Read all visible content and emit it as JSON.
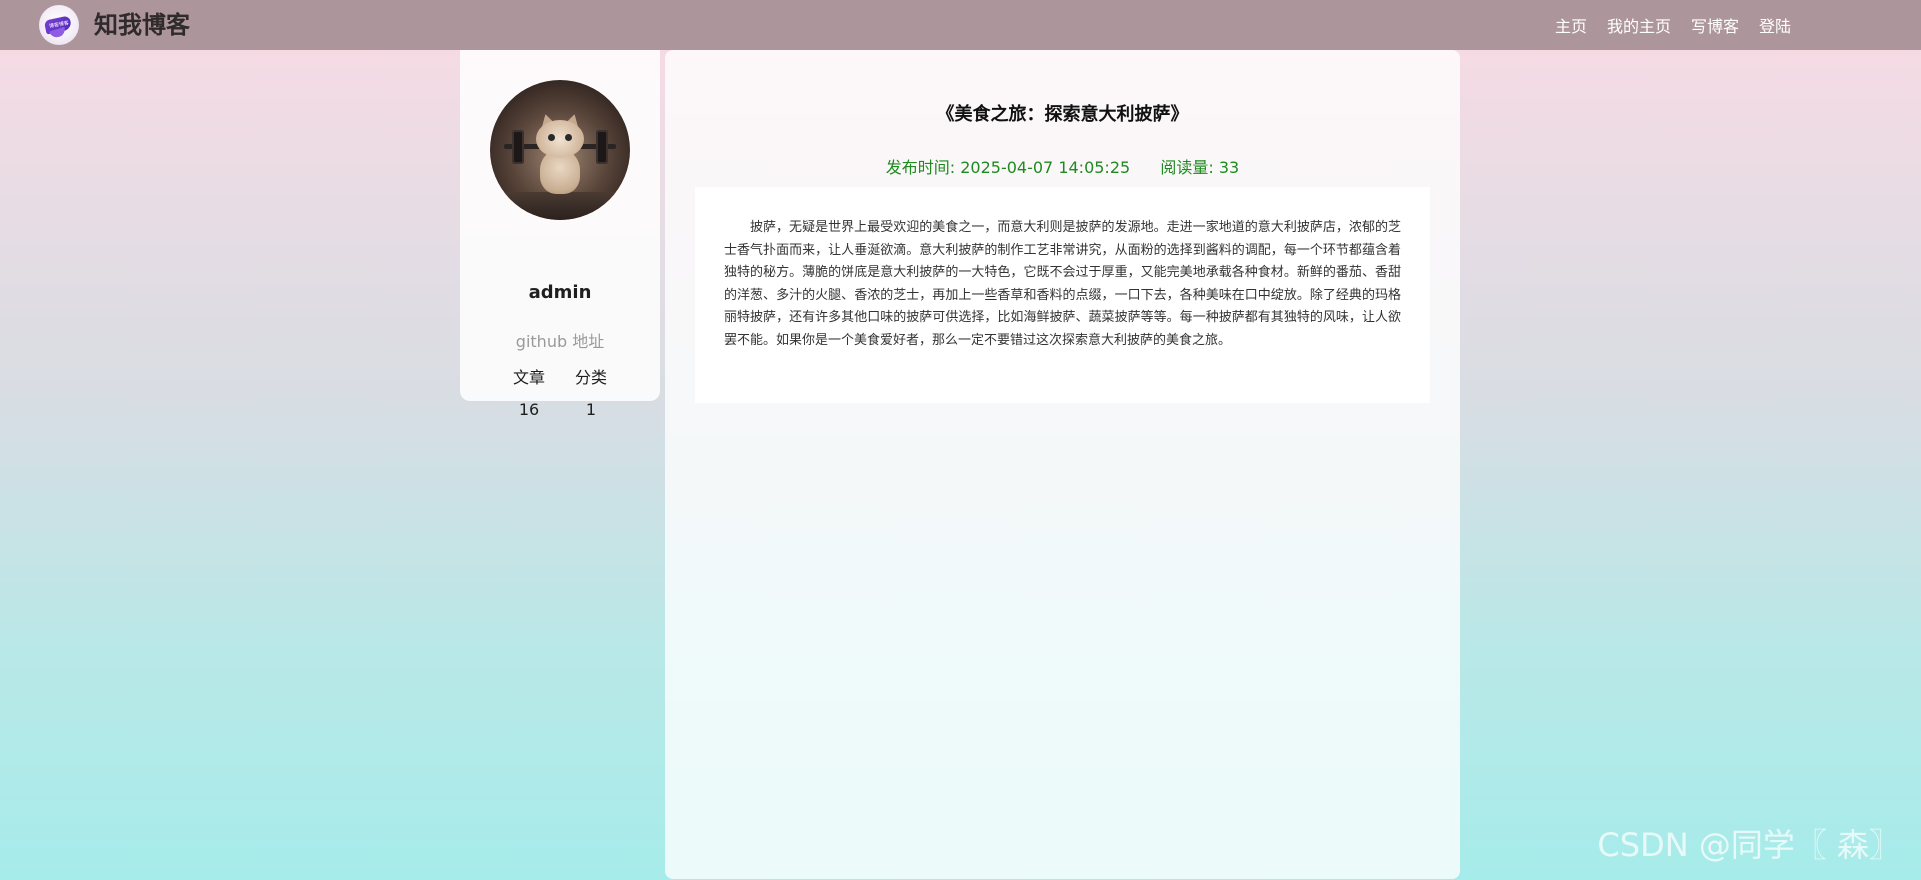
{
  "header": {
    "site_name": "知我博客",
    "logo_text": "博客博客",
    "nav": [
      "主页",
      "我的主页",
      "写博客",
      "登陆"
    ]
  },
  "profile": {
    "username": "admin",
    "github_label": "github 地址",
    "stats": [
      {
        "label": "文章",
        "value": "16"
      },
      {
        "label": "分类",
        "value": "1"
      }
    ]
  },
  "article": {
    "title": "《美食之旅：探索意大利披萨》",
    "publish_label": "发布时间:",
    "publish_time": "2025-04-07 14:05:25",
    "views_label": "阅读量:",
    "views": "33",
    "content": "披萨，无疑是世界上最受欢迎的美食之一，而意大利则是披萨的发源地。走进一家地道的意大利披萨店，浓郁的芝士香气扑面而来，让人垂涎欲滴。意大利披萨的制作工艺非常讲究，从面粉的选择到酱料的调配，每一个环节都蕴含着独特的秘方。薄脆的饼底是意大利披萨的一大特色，它既不会过于厚重，又能完美地承载各种食材。新鲜的番茄、香甜的洋葱、多汁的火腿、香浓的芝士，再加上一些香草和香料的点缀，一口下去，各种美味在口中绽放。除了经典的玛格丽特披萨，还有许多其他口味的披萨可供选择，比如海鲜披萨、蔬菜披萨等等。每一种披萨都有其独特的风味，让人欲罢不能。如果你是一个美食爱好者，那么一定不要错过这次探索意大利披萨的美食之旅。"
  },
  "watermark": "CSDN @同学〖 森〗",
  "colors": {
    "navbar": "#ad959c",
    "meta_text": "#1f8a1f",
    "nav_text": "#ffffff"
  }
}
